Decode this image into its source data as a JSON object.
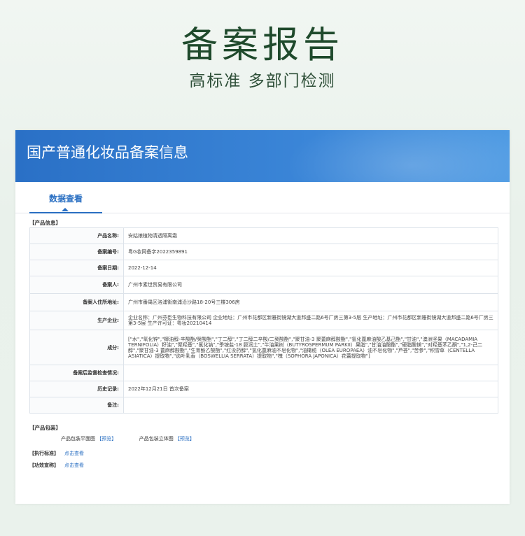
{
  "hero": {
    "title": "备案报告",
    "subtitle": "高标准 多部门检测"
  },
  "panel": {
    "title": "国产普通化妆品备案信息",
    "tab": "数据查看",
    "section_product": "【产品信息】",
    "rows": [
      {
        "label": "产品名称:",
        "value": "安姑娘植物清透隔离霜"
      },
      {
        "label": "备案编号:",
        "value": "粤G妆网备字2022359891"
      },
      {
        "label": "备案日期:",
        "value": "2022-12-14"
      },
      {
        "label": "备案人:",
        "value": "广州市素世贸易有限公司"
      },
      {
        "label": "备案人住所地址:",
        "value": "广州市番禺区洛浦街南浦沿沙路18-20号三楼306房"
      },
      {
        "label": "生产企业:",
        "value": "企业名称：广州芬臣生物科技有限公司 企业地址：广州市花都区新雅街镜湖大道邦盛二路6号厂房三第3-5层 生产地址：广州市花都区新雅街镜湖大道邦盛二路6号厂房三第3-5层 生产许可证：粤妆20210414"
      },
      {
        "label": "成分:",
        "value": "[\"水\",\"氧化锌\",\"椰油醇-辛酸酯/癸酸酯\",\"丁二醇\",\"丁二醇二辛酸/二癸酸酯\",\"聚甘油-3 聚蓖麻醇酸酯\",\"氢化蓖麻油酸乙基己酯\",\"甘油\",\"澳洲坚果（MACADAMIA TERNIFOLIA）籽油\",\"聚羟基\",\"氯化钠\",\"季铵盐-18 膨润土\",\"牛油果树（BUTYROSPERMUM PARKII）果脂\",\"甘油油酸酯\",\"硬脂酸镁\",\"对羟基苯乙酮\",\"1,2-己二醇\",\"聚甘油-3 蓖麻醇酸酯\",\"生育酚乙酸酯\",\"红没药醇\",\"氢化蓖麻油不皂化物\",\"油橄榄（OLEA EUROPAEA）油不皂化物\",\"芦荟\",\"苦参\",\"积雪草（CENTELLA ASIATICA）提取物\",\"齿叶乳香（BOSWELLIA SERRATA）提取物\",\"槐（SOPHORA JAPONICA）花蕾提取物\"]"
      },
      {
        "label": "备案后监督检查情况:",
        "value": ""
      },
      {
        "label": "历史记录:",
        "value": "2022年12月21日 首次备案"
      },
      {
        "label": "备注:",
        "value": ""
      }
    ],
    "section_package": "【产品包装】",
    "package_flat": "产品包装平面图",
    "package_3d": "产品包装立体图",
    "preview": "【预览】",
    "section_standard": "【执行标准】",
    "section_efficacy": "【功效宣称】",
    "click_view": "点击查看"
  },
  "colors": {
    "banner": "#2a70c6",
    "accent": "#2a6fc2",
    "hero_text": "#1f4a2c"
  }
}
